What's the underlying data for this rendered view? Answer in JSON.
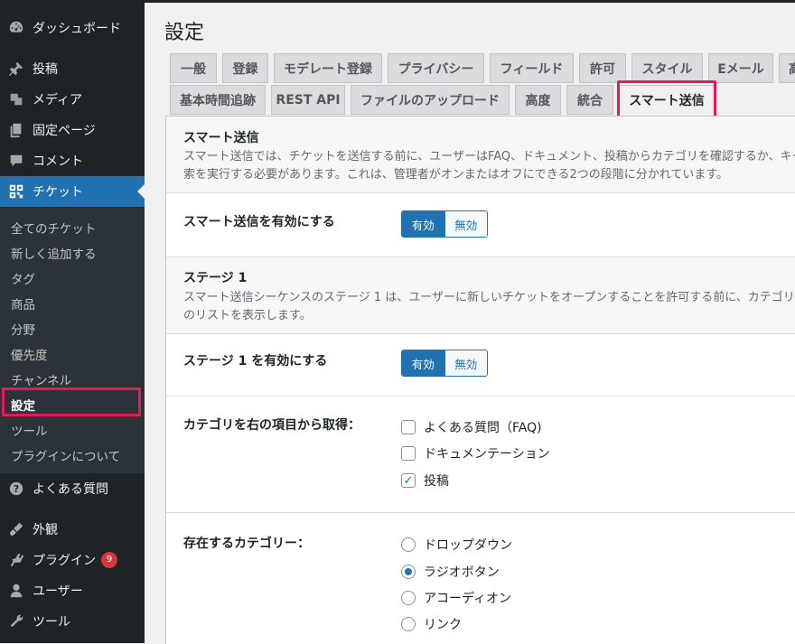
{
  "sidebar": {
    "items": [
      {
        "label": "ダッシュボード",
        "icon": "dashboard-icon"
      },
      {
        "label": "投稿",
        "icon": "pin-icon"
      },
      {
        "label": "メディア",
        "icon": "media-icon"
      },
      {
        "label": "固定ページ",
        "icon": "pages-icon"
      },
      {
        "label": "コメント",
        "icon": "comment-icon"
      },
      {
        "label": "チケット",
        "icon": "tickets-icon"
      },
      {
        "label": "よくある質問",
        "icon": "help-icon"
      },
      {
        "label": "外観",
        "icon": "appearance-icon"
      },
      {
        "label": "プラグイン",
        "icon": "plugin-icon",
        "badge": "9"
      },
      {
        "label": "ユーザー",
        "icon": "user-icon"
      },
      {
        "label": "ツール",
        "icon": "wrench-icon"
      }
    ],
    "submenu": [
      "全てのチケット",
      "新しく追加する",
      "タグ",
      "商品",
      "分野",
      "優先度",
      "チャンネル",
      "設定",
      "ツール",
      "プラグインについて"
    ]
  },
  "page": {
    "title": "設定"
  },
  "tabs": {
    "row1": [
      "一般",
      "登録",
      "モデレート登録",
      "プライバシー",
      "フィールド",
      "許可",
      "スタイル",
      "Eメール",
      "高"
    ],
    "row2": [
      "基本時間追跡",
      "REST API",
      "ファイルのアップロード",
      "高度",
      "統合",
      "スマート送信"
    ]
  },
  "smart": {
    "title": "スマート送信",
    "desc_line1": "スマート送信では、チケットを送信する前に、ユーザーはFAQ、ドキュメント、投稿からカテゴリを確認するか、キー",
    "desc_line2": "索を実行する必要があります。これは、管理者がオンまたはオフにできる2つの段階に分かれています。",
    "enable_label": "スマート送信を有効にする",
    "toggle_on": "有効",
    "toggle_off": "無効"
  },
  "stage1": {
    "title": "ステージ 1",
    "desc_line1": "スマート送信シーケンスのステージ 1 は、ユーザーに新しいチケットをオープンすることを許可する前に、カテゴリー",
    "desc_line2": "のリストを表示します。",
    "enable_label": "ステージ 1 を有効にする",
    "toggle_on": "有効",
    "toggle_off": "無効",
    "source_label": "カテゴリを右の項目から取得：",
    "sources": [
      {
        "label": "よくある質問（FAQ)",
        "checked": false
      },
      {
        "label": "ドキュメンテーション",
        "checked": false
      },
      {
        "label": "投稿",
        "checked": true
      }
    ],
    "existing_label": "存在するカテゴリー：",
    "layouts": [
      {
        "label": "ドロップダウン",
        "selected": false
      },
      {
        "label": "ラジオボタン",
        "selected": true
      },
      {
        "label": "アコーディオン",
        "selected": false
      },
      {
        "label": "リンク",
        "selected": false
      }
    ]
  },
  "colors": {
    "accent": "#2271b1",
    "highlight": "#e6195b",
    "sidebar_bg": "#1d2327"
  }
}
